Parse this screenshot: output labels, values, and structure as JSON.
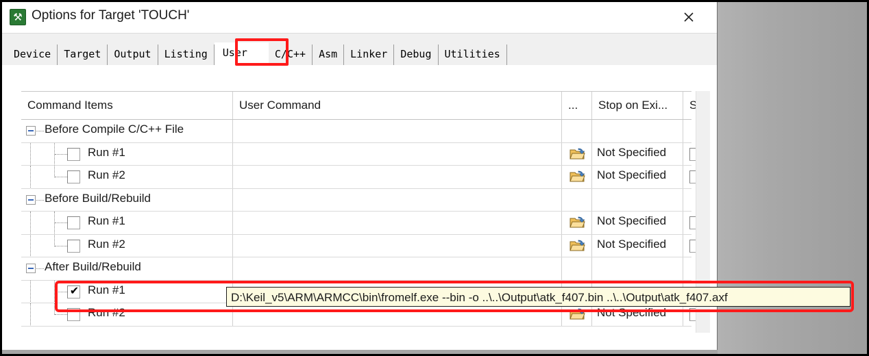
{
  "window": {
    "title": "Options for Target 'TOUCH'",
    "app_icon": "keil-uvision-icon",
    "close_label": "×"
  },
  "tabs": [
    {
      "label": "Device",
      "selected": false
    },
    {
      "label": "Target",
      "selected": false
    },
    {
      "label": "Output",
      "selected": false
    },
    {
      "label": "Listing",
      "selected": false
    },
    {
      "label": "User",
      "selected": true
    },
    {
      "label": "C/C++",
      "selected": false
    },
    {
      "label": "Asm",
      "selected": false
    },
    {
      "label": "Linker",
      "selected": false
    },
    {
      "label": "Debug",
      "selected": false
    },
    {
      "label": "Utilities",
      "selected": false
    }
  ],
  "grid": {
    "columns": [
      {
        "key": "command_items",
        "label": "Command Items"
      },
      {
        "key": "user_command",
        "label": "User Command"
      },
      {
        "key": "browse",
        "label": "..."
      },
      {
        "key": "stop_on_exit",
        "label": "Stop on Exi..."
      },
      {
        "key": "s",
        "label": "S..."
      }
    ],
    "rows": [
      {
        "type": "group",
        "label": "Before Compile C/C++ File",
        "expanded": true,
        "user_command": "",
        "browse": false,
        "stop_on_exit": "",
        "has_s": false
      },
      {
        "type": "item",
        "label": "Run #1",
        "checked": false,
        "user_command": "",
        "browse": true,
        "stop_on_exit": "Not Specified",
        "has_s": true
      },
      {
        "type": "item",
        "label": "Run #2",
        "checked": false,
        "user_command": "",
        "browse": true,
        "stop_on_exit": "Not Specified",
        "has_s": true
      },
      {
        "type": "group",
        "label": "Before Build/Rebuild",
        "expanded": true,
        "user_command": "",
        "browse": false,
        "stop_on_exit": "",
        "has_s": false
      },
      {
        "type": "item",
        "label": "Run #1",
        "checked": false,
        "user_command": "",
        "browse": true,
        "stop_on_exit": "Not Specified",
        "has_s": true
      },
      {
        "type": "item",
        "label": "Run #2",
        "checked": false,
        "user_command": "",
        "browse": true,
        "stop_on_exit": "Not Specified",
        "has_s": true
      },
      {
        "type": "group",
        "label": "After Build/Rebuild",
        "expanded": true,
        "user_command": "",
        "browse": false,
        "stop_on_exit": "",
        "has_s": false
      },
      {
        "type": "item",
        "label": "Run #1",
        "checked": true,
        "user_command": "",
        "browse": false,
        "stop_on_exit": "",
        "has_s": false
      },
      {
        "type": "item",
        "label": "Run #2",
        "checked": false,
        "user_command": "",
        "browse": true,
        "stop_on_exit": "Not Specified",
        "has_s": true
      }
    ]
  },
  "edit_box": {
    "value": "D:\\Keil_v5\\ARM\\ARMCC\\bin\\fromelf.exe --bin -o ..\\..\\Output\\atk_f407.bin ..\\..\\Output\\atk_f407.axf",
    "placeholder": ""
  },
  "annotations": {
    "tab_highlight": "User",
    "row_highlight": "After Build/Rebuild Run #1",
    "color": "#ff1a1a"
  },
  "theme": {
    "dialog_background": "#ffffff",
    "desktop_background": "#a6a6a6",
    "tab_strip_background": "#f0f0f0",
    "edit_background": "#fdfbe0",
    "folder_icon_color": "#f0c05a"
  }
}
